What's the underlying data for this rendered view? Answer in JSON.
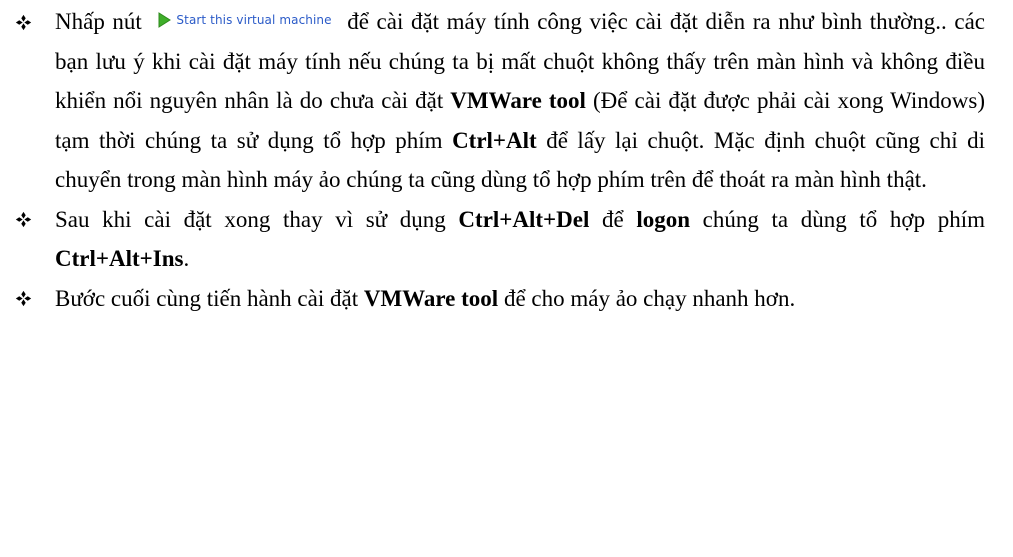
{
  "bullet_icon": "four-diamond-bullet-icon",
  "colors": {
    "text": "#000000",
    "button_label": "#2b5bc8",
    "play_icon": "#3fae2a"
  },
  "paragraph1": {
    "t1": "Nhấp nút ",
    "button": {
      "icon": "play-icon",
      "label": "Start this virtual machine"
    },
    "t2": " để cài đặt máy tính công việc cài đặt diễn ra như bình thường.. các bạn lưu ý khi cài đặt máy tính nếu chúng ta bị mất chuột không thấy trên màn hình và không điều khiển nổi nguyên nhân là do chưa cài đặt ",
    "b1": "VMWare tool",
    "t3": " (Để cài đặt được phải cài xong Windows) tạm thời chúng ta sử dụng tổ hợp phím ",
    "b2": "Ctrl+Alt",
    "t4": " để lấy lại chuột. Mặc định chuột cũng chỉ di chuyển trong màn hình máy ảo chúng ta cũng dùng tổ hợp phím trên để thoát ra màn hình thật."
  },
  "paragraph2": {
    "t1": "Sau khi cài đặt xong thay vì sử dụng ",
    "b1": "Ctrl+Alt+Del",
    "t2": " để ",
    "b2": "logon",
    "t3": " chúng ta dùng tổ hợp phím ",
    "b3": "Ctrl+Alt+Ins",
    "t4": "."
  },
  "paragraph3": {
    "t1": "Bước cuối cùng tiến hành cài đặt ",
    "b1": "VMWare tool",
    "t2": " để cho máy ảo chạy nhanh hơn."
  }
}
